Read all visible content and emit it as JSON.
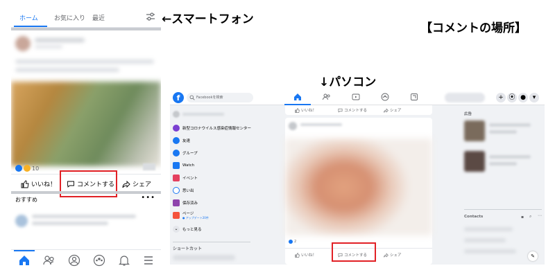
{
  "annotations": {
    "phone_label": "←スマートフォン",
    "pc_label": "↓パソコン",
    "location_label": "【コメントの場所】"
  },
  "colors": {
    "accent": "#1877f2",
    "highlight": "#e12025",
    "text": "#050505",
    "muted": "#65676b"
  },
  "phone": {
    "tabs": [
      {
        "label": "ホーム",
        "active": true
      },
      {
        "label": "お気に入り",
        "active": false
      },
      {
        "label": "最近",
        "active": false
      }
    ],
    "post": {
      "reaction_count": "10",
      "actions": {
        "like": "いいね！",
        "comment": "コメントする",
        "share": "シェア"
      }
    },
    "recommended": {
      "title": "おすすめ",
      "more": "•••"
    },
    "bottom_nav": [
      "home-icon",
      "friends-icon",
      "profile-icon",
      "groups-icon",
      "bell-icon",
      "menu-icon"
    ]
  },
  "desktop": {
    "logo": "f",
    "search_placeholder": "Facebookを検索",
    "top_nav": [
      "home-icon",
      "friends-icon",
      "watch-icon",
      "groups-icon",
      "gaming-icon"
    ],
    "topbar_buttons": [
      "+",
      "⦿",
      "●",
      "▾"
    ],
    "left_menu": [
      {
        "label": "新型コロナウイルス感染症情報センター",
        "icon": "covid-info-icon",
        "color": "#7a3fd1"
      },
      {
        "label": "友達",
        "icon": "friends-icon",
        "color": "#1877f2"
      },
      {
        "label": "グループ",
        "icon": "groups-icon",
        "color": "#1877f2"
      },
      {
        "label": "Watch",
        "icon": "watch-icon",
        "color": "#1877f2"
      },
      {
        "label": "イベント",
        "icon": "events-icon",
        "color": "#e4405f"
      },
      {
        "label": "思い出",
        "icon": "memories-icon",
        "color": "#1877f2"
      },
      {
        "label": "保存済み",
        "icon": "saved-icon",
        "color": "#8e44ad"
      },
      {
        "label": "ページ",
        "icon": "pages-icon",
        "color": "#f5533d",
        "sub": "● アップデート20件"
      },
      {
        "label": "もっと見る",
        "icon": "more-icon",
        "color": "#e4e6eb"
      }
    ],
    "shortcuts_title": "ショートカット",
    "post_actions": {
      "like": "いいね！",
      "comment": "コメントする",
      "share": "シェア"
    },
    "post_reaction_count": "2",
    "right": {
      "ads_title": "広告",
      "contacts_title": "Contacts"
    }
  }
}
